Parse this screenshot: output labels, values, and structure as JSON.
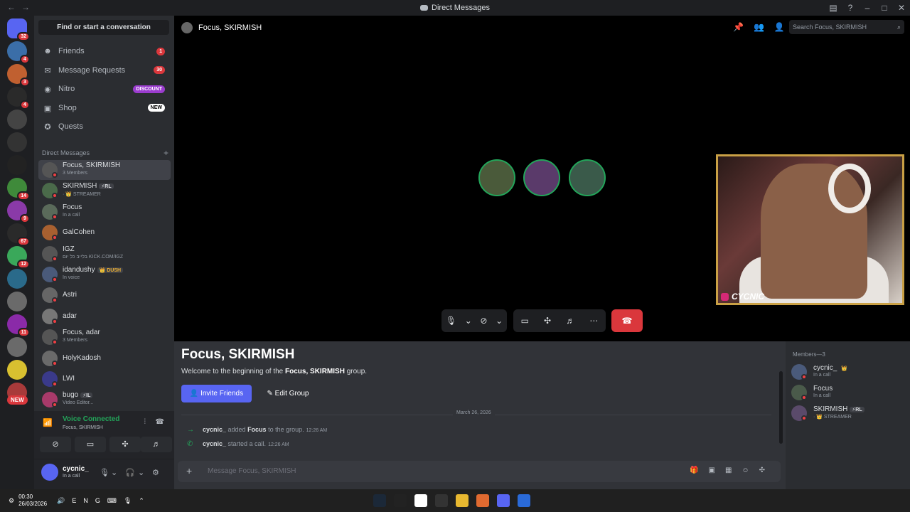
{
  "titlebar": {
    "title": "Direct Messages",
    "nav_back": "←",
    "nav_fwd": "→"
  },
  "servers": {
    "items": [
      {
        "badge": "32",
        "color": "#5865f2"
      },
      {
        "badge": "4",
        "color": "#3b6ea8"
      },
      {
        "badge": "3",
        "color": "#c06030"
      },
      {
        "badge": "4",
        "color": "#2a2a2a"
      },
      {
        "badge": "",
        "color": "#444444"
      },
      {
        "badge": "",
        "color": "#333333"
      },
      {
        "badge": "",
        "color": "#222222"
      },
      {
        "badge": "14",
        "color": "#3f8a3a"
      },
      {
        "badge": "9",
        "color": "#8a3aa8"
      },
      {
        "badge": "67",
        "color": "#2a2a2a"
      },
      {
        "badge": "12",
        "color": "#3aa85a"
      },
      {
        "badge": "",
        "color": "#2a6a8a"
      },
      {
        "badge": "",
        "color": "#6a6a6a"
      },
      {
        "badge": "11",
        "color": "#8a2aa8"
      },
      {
        "badge": "",
        "color": "#6a6a6a"
      },
      {
        "badge": "",
        "color": "#d8c030"
      },
      {
        "badge": "",
        "color": "#a83a3a"
      }
    ],
    "new_label": "NEW"
  },
  "sidebar": {
    "find_label": "Find or start a conversation",
    "nav": [
      {
        "label": "Friends",
        "pill": "1",
        "pill_color": "#da373c",
        "icon": "friends-icon",
        "glyph": "☻"
      },
      {
        "label": "Message Requests",
        "pill": "30",
        "pill_color": "#da373c",
        "icon": "mail-icon",
        "glyph": "✉"
      },
      {
        "label": "Nitro",
        "pill": "DISCOUNT",
        "pill_color": "#9b3ccf",
        "icon": "nitro-icon",
        "glyph": "◉"
      },
      {
        "label": "Shop",
        "pill": "NEW",
        "pill_color": "#ffffff",
        "icon": "shop-icon",
        "glyph": "▣"
      },
      {
        "label": "Quests",
        "pill": "",
        "pill_color": "",
        "icon": "quests-icon",
        "glyph": "✪"
      }
    ],
    "dm_header": "Direct Messages",
    "dm_add": "+",
    "dms": [
      {
        "name": "Focus, SKIRMISH",
        "sub": "3 Members",
        "tag": "",
        "active": true,
        "color": "#555555"
      },
      {
        "name": "SKIRMISH",
        "sub": "· 👑 STREAMER",
        "tag": "⚡RL",
        "active": false,
        "color": "#4a6a4a"
      },
      {
        "name": "Focus",
        "sub": "In a call",
        "tag": "",
        "active": false,
        "color": "#5a6a5a"
      },
      {
        "name": "GalCohen",
        "sub": "",
        "tag": "",
        "active": false,
        "color": "#a86030"
      },
      {
        "name": "IGZ",
        "sub": "בלייב כל יום KICK.COM/IGZ",
        "tag": "",
        "active": false,
        "color": "#555555"
      },
      {
        "name": "idandushy",
        "sub": "In voice",
        "tag": "👑 DUSH",
        "active": false,
        "color": "#4a5a7a"
      },
      {
        "name": "Astri",
        "sub": "",
        "tag": "",
        "active": false,
        "color": "#666666"
      },
      {
        "name": "adar",
        "sub": "",
        "tag": "",
        "active": false,
        "color": "#777777"
      },
      {
        "name": "Focus, adar",
        "sub": "3 Members",
        "tag": "",
        "active": false,
        "color": "#555555"
      },
      {
        "name": "HolyKadosh",
        "sub": "",
        "tag": "",
        "active": false,
        "color": "#6a6a6a"
      },
      {
        "name": "LWI",
        "sub": "",
        "tag": "",
        "active": false,
        "color": "#3a3a8a"
      },
      {
        "name": "bugo",
        "sub": "Video Editor...",
        "tag": "⚡IL",
        "active": false,
        "color": "#a83a6a"
      }
    ]
  },
  "voice": {
    "title": "Voice Connected",
    "sub": "Focus, SKIRMISH",
    "buttons": [
      "camera-off-icon",
      "screenshare-icon",
      "activities-icon",
      "soundboard-icon"
    ]
  },
  "user": {
    "name": "cycnic_",
    "status": "In a call"
  },
  "call": {
    "header_title": "Focus, SKIRMISH",
    "search_placeholder": "Search Focus, SKIRMISH",
    "participants": [
      {
        "color": "#4a5a3a"
      },
      {
        "color": "#5a3a6a"
      },
      {
        "color": "#3a5a4a"
      }
    ],
    "stream_label": "CYCNIC"
  },
  "chat": {
    "title": "Focus, SKIRMISH",
    "welcome_pre": "Welcome to the beginning of the ",
    "welcome_bold": "Focus, SKIRMISH",
    "welcome_post": " group.",
    "invite_label": "Invite Friends",
    "edit_label": "Edit Group",
    "date": "March 26, 2026",
    "messages": [
      {
        "user": "cycnic_",
        "text1": " added ",
        "bold": "Focus",
        "text2": " to the group.",
        "time": "12:26 AM",
        "icon": "→"
      },
      {
        "user": "cycnic_",
        "text1": " started a call.",
        "bold": "",
        "text2": "",
        "time": "12:26 AM",
        "icon": "✆"
      }
    ],
    "input_placeholder": "Message Focus, SKIRMISH"
  },
  "members": {
    "header": "Members—3",
    "list": [
      {
        "name": "cycnic_",
        "sub": "In a call",
        "tag": "👑",
        "color": "#4a5a7a"
      },
      {
        "name": "Focus",
        "sub": "In a call",
        "tag": "",
        "color": "#4a5a4a"
      },
      {
        "name": "SKIRMISH",
        "sub": "· 👑 STREAMER",
        "tag": "⚡RL",
        "color": "#5a4a6a"
      }
    ]
  },
  "taskbar": {
    "time": "00:30",
    "date": "26/03/2026",
    "lang": "ENG",
    "apps": [
      "#1b2838",
      "#222222",
      "#ffffff",
      "#333333",
      "#e8b830",
      "#e06a30",
      "#5865f2",
      "#2a6ad8"
    ]
  }
}
